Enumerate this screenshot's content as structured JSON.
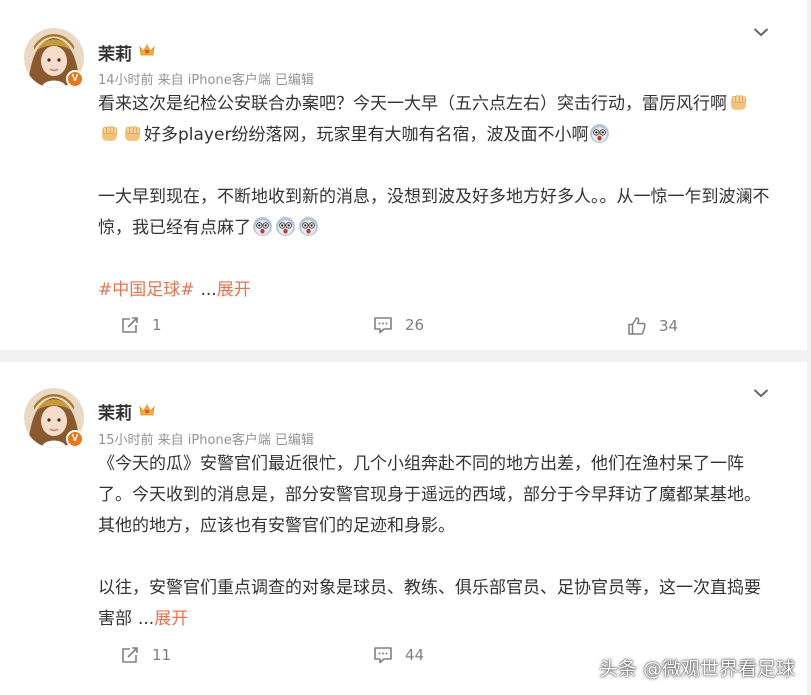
{
  "posts": [
    {
      "author": "茉莉",
      "meta": "14小时前  来自 iPhone客户端  已编辑",
      "para1_a": "看来这次是纪检公安联合办案吧？今天一大早（五六点左右）突击行动，雷厉风行啊",
      "para1_b": "好多player纷纷落网，玩家里有大咖有名宿，波及面不小啊",
      "para2": "一大早到现在，不断地收到新的消息，没想到波及好多地方好多人。。从一惊一乍到波澜不惊，我已经有点麻了",
      "topic": "#中国足球#",
      "ellipsis": "...",
      "more": "展开",
      "share_count": "1",
      "comment_count": "26",
      "like_count": "34"
    },
    {
      "author": "茉莉",
      "meta": "15小时前  来自 iPhone客户端  已编辑",
      "para1": "《今天的瓜》安警官们最近很忙，几个小组奔赴不同的地方出差，他们在渔村呆了一阵了。今天收到的消息是，部分安警官现身于遥远的西域，部分于今早拜访了魔都某基地。其他的地方，应该也有安警官们的足迹和身影。",
      "para2": "以往，安警官们重点调查的对象是球员、教练、俱乐部官员、足协官员等，这一次直捣要害部",
      "ellipsis": "...",
      "more": "展开",
      "share_count": "11",
      "comment_count": "44"
    }
  ],
  "watermark": "头条 @微观世界看足球",
  "icons": {
    "share": "share-icon",
    "comment": "comment-icon",
    "like": "like-icon",
    "fist": "fist-emoji",
    "shock": "shock-emoji",
    "crown": "crown-icon",
    "verified": "verified-badge-icon",
    "chevron": "chevron-down-icon"
  },
  "colors": {
    "link": "#eb7350",
    "meta": "#939393",
    "text": "#333333",
    "badge": "#e8761a"
  }
}
